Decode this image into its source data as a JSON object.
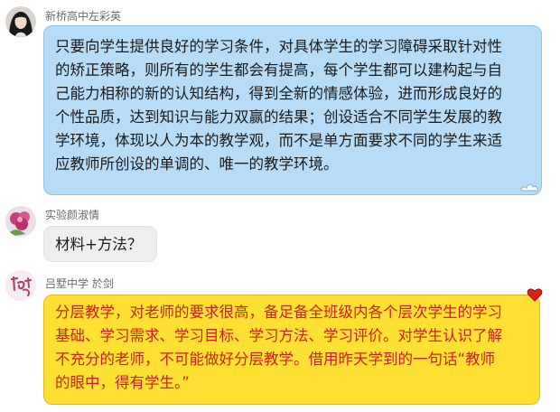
{
  "messages": [
    {
      "sender": "新桥高中左彩英",
      "avatar_icon": "profile-photo-icon",
      "lines": [
        "只要向学生提供良好的学习条件，对具体学生的学习障碍采取针对性",
        "的矫正策略，则所有的学生都会有提高，每个学生都可以建构起与自",
        "己能力相称的新的认知结构，得到全新的情感体验，进而形成良好的",
        "个性品质，达到知识与能力双赢的结果；创设适合不同学生发展的教",
        "学环境，体现以人为本的教学观，而不是单方面要求不同的学生来适",
        "应教师所创设的单调的、唯一的教学环境。"
      ],
      "bubble_color": "#b7dcf7"
    },
    {
      "sender": "实验颜淑情",
      "avatar_icon": "flower-photo-icon",
      "lines": [
        "材料+方法？"
      ],
      "bubble_color": "#eeeeee"
    },
    {
      "sender": "吕墅中学  於剑",
      "avatar_icon": "calligraphy-avatar-icon",
      "lines": [
        "分层教学，对老师的要求很高，备足备全班级内各个层次学生的学习",
        "基础、学习需求、学习目标、学习方法、学习评价。对学生认识了解",
        "不充分的老师，不可能做好分层教学。借用昨天学到的一句话“教师",
        "的眼中，得有学生。”"
      ],
      "bubble_color": "#ffe033",
      "text_color": "#d21f16"
    }
  ]
}
